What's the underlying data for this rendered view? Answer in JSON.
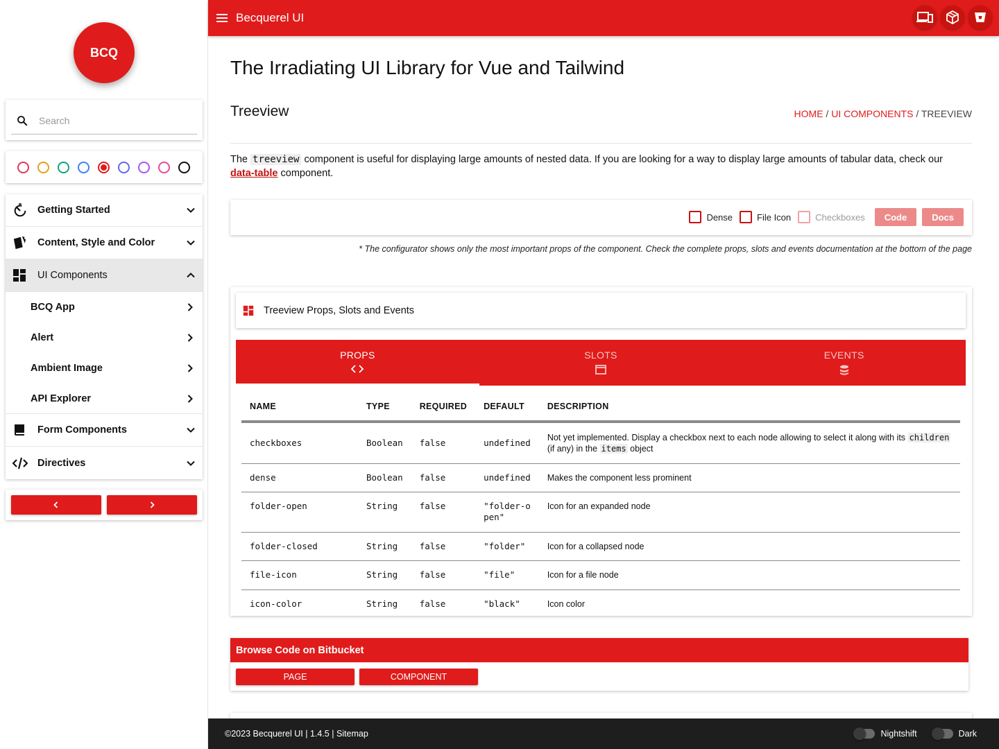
{
  "sidebar": {
    "logo": "BCQ",
    "search_placeholder": "Search",
    "color_swatches": [
      {
        "name": "rose",
        "color": "#e2365f",
        "selected": false
      },
      {
        "name": "amber",
        "color": "#e3a21a",
        "selected": false
      },
      {
        "name": "emerald",
        "color": "#10a37f",
        "selected": false
      },
      {
        "name": "blue",
        "color": "#3b82f6",
        "selected": false
      },
      {
        "name": "red",
        "color": "#e01b1b",
        "selected": true
      },
      {
        "name": "indigo",
        "color": "#6366f1",
        "selected": false
      },
      {
        "name": "purple",
        "color": "#a855f7",
        "selected": false
      },
      {
        "name": "pink",
        "color": "#ec4899",
        "selected": false
      },
      {
        "name": "black",
        "color": "#111111",
        "selected": false
      }
    ],
    "nav": [
      {
        "label": "Getting Started",
        "icon": "timer-icon",
        "expanded": false
      },
      {
        "label": "Content, Style and Color",
        "icon": "cards-icon",
        "expanded": false
      },
      {
        "label": "UI Components",
        "icon": "dashboard-icon",
        "expanded": true,
        "children": [
          "BCQ App",
          "Alert",
          "Ambient Image",
          "API Explorer"
        ]
      },
      {
        "label": "Form Components",
        "icon": "form-icon",
        "expanded": false
      },
      {
        "label": "Directives",
        "icon": "code-icon",
        "expanded": false
      }
    ]
  },
  "topbar": {
    "title": "Becquerel UI",
    "actions": [
      "devices-icon",
      "codesandbox-icon",
      "bitbucket-icon"
    ]
  },
  "main": {
    "title": "The Irradiating UI Library for Vue and Tailwind",
    "section_title": "Treeview",
    "breadcrumb": {
      "home": "HOME",
      "sep": " / ",
      "ui_components": "UI COMPONENTS",
      "current": "TREEVIEW"
    },
    "intro": {
      "pre": "The ",
      "code": "treeview",
      "mid": " component is useful for displaying large amounts of nested data. If you are looking for a way to display large amounts of tabular data, check our ",
      "link": "data-table",
      "post": " component."
    },
    "configurator": {
      "checkboxes": [
        {
          "label": "Dense",
          "checked": false,
          "disabled": false
        },
        {
          "label": "File Icon",
          "checked": false,
          "disabled": false
        },
        {
          "label": "Checkboxes",
          "checked": false,
          "disabled": true
        }
      ],
      "code_label": "Code",
      "docs_label": "Docs"
    },
    "note": "* The configurator shows only the most important props of the component. Check the complete props, slots and events documentation at the bottom of the page",
    "props_card": {
      "title": "Treeview Props, Slots and Events",
      "tabs": [
        {
          "label": "PROPS",
          "icon": "code-brackets-icon",
          "active": true
        },
        {
          "label": "SLOTS",
          "icon": "window-icon",
          "active": false
        },
        {
          "label": "EVENTS",
          "icon": "database-icon",
          "active": false
        }
      ],
      "columns": [
        "NAME",
        "TYPE",
        "REQUIRED",
        "DEFAULT",
        "DESCRIPTION"
      ],
      "rows": [
        {
          "name": "checkboxes",
          "type": "Boolean",
          "required": "false",
          "default": "undefined",
          "desc_pre": "Not yet implemented. Display a checkbox next to each node allowing to select it along with its ",
          "desc_code1": "children",
          "desc_mid": " (if any) in the ",
          "desc_code2": "items",
          "desc_post": " object"
        },
        {
          "name": "dense",
          "type": "Boolean",
          "required": "false",
          "default": "undefined",
          "desc": "Makes the component less prominent"
        },
        {
          "name": "folder-open",
          "type": "String",
          "required": "false",
          "default": "\"folder-open\"",
          "desc": "Icon for an expanded node"
        },
        {
          "name": "folder-closed",
          "type": "String",
          "required": "false",
          "default": "\"folder\"",
          "desc": "Icon for a collapsed node"
        },
        {
          "name": "file-icon",
          "type": "String",
          "required": "false",
          "default": "\"file\"",
          "desc": "Icon for a file node"
        },
        {
          "name": "icon-color",
          "type": "String",
          "required": "false",
          "default": "\"black\"",
          "desc": "Icon color"
        }
      ]
    },
    "bitbucket": {
      "title": "Browse Code on Bitbucket",
      "page_label": "PAGE",
      "component_label": "COMPONENT"
    }
  },
  "footer": {
    "copyright": "©2023 Becquerel UI | 1.4.5 | ",
    "sitemap": "Sitemap",
    "nightshift_label": "Nightshift",
    "nightshift_on": false,
    "dark_label": "Dark",
    "dark_on": false
  },
  "colors": {
    "accent": "#e01b1b",
    "footer": "#1e1e1e"
  }
}
